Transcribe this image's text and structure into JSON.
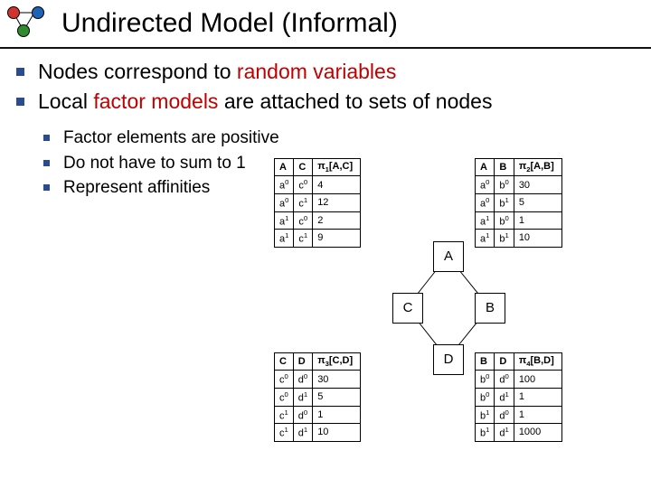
{
  "title": "Undirected Model (Informal)",
  "bullets": {
    "b1_pre": "Nodes correspond to ",
    "b1_hi": "random variables",
    "b2_pre": "Local ",
    "b2_hi": "factor models",
    "b2_post": " are attached to sets of nodes",
    "sub1": "Factor elements are positive",
    "sub2": "Do not have to sum to 1",
    "sub3": "Represent affinities"
  },
  "col3_prefix": "π",
  "tables": {
    "ac": {
      "h1": "A",
      "h2": "C",
      "h3_sub": "1",
      "h3_args": "[A,C]",
      "rows": [
        {
          "a": "a",
          "ae": "0",
          "b": "c",
          "be": "0",
          "v": "4"
        },
        {
          "a": "a",
          "ae": "0",
          "b": "c",
          "be": "1",
          "v": "12"
        },
        {
          "a": "a",
          "ae": "1",
          "b": "c",
          "be": "0",
          "v": "2"
        },
        {
          "a": "a",
          "ae": "1",
          "b": "c",
          "be": "1",
          "v": "9"
        }
      ]
    },
    "ab": {
      "h1": "A",
      "h2": "B",
      "h3_sub": "2",
      "h3_args": "[A,B]",
      "rows": [
        {
          "a": "a",
          "ae": "0",
          "b": "b",
          "be": "0",
          "v": "30"
        },
        {
          "a": "a",
          "ae": "0",
          "b": "b",
          "be": "1",
          "v": "5"
        },
        {
          "a": "a",
          "ae": "1",
          "b": "b",
          "be": "0",
          "v": "1"
        },
        {
          "a": "a",
          "ae": "1",
          "b": "b",
          "be": "1",
          "v": "10"
        }
      ]
    },
    "cd": {
      "h1": "C",
      "h2": "D",
      "h3_sub": "3",
      "h3_args": "[C,D]",
      "rows": [
        {
          "a": "c",
          "ae": "0",
          "b": "d",
          "be": "0",
          "v": "30"
        },
        {
          "a": "c",
          "ae": "0",
          "b": "d",
          "be": "1",
          "v": "5"
        },
        {
          "a": "c",
          "ae": "1",
          "b": "d",
          "be": "0",
          "v": "1"
        },
        {
          "a": "c",
          "ae": "1",
          "b": "d",
          "be": "1",
          "v": "10"
        }
      ]
    },
    "bd": {
      "h1": "B",
      "h2": "D",
      "h3_sub": "4",
      "h3_args": "[B,D]",
      "rows": [
        {
          "a": "b",
          "ae": "0",
          "b": "d",
          "be": "0",
          "v": "100"
        },
        {
          "a": "b",
          "ae": "0",
          "b": "d",
          "be": "1",
          "v": "1"
        },
        {
          "a": "b",
          "ae": "1",
          "b": "d",
          "be": "0",
          "v": "1"
        },
        {
          "a": "b",
          "ae": "1",
          "b": "d",
          "be": "1",
          "v": "1000"
        }
      ]
    }
  },
  "graph": {
    "A": "A",
    "B": "B",
    "C": "C",
    "D": "D"
  }
}
